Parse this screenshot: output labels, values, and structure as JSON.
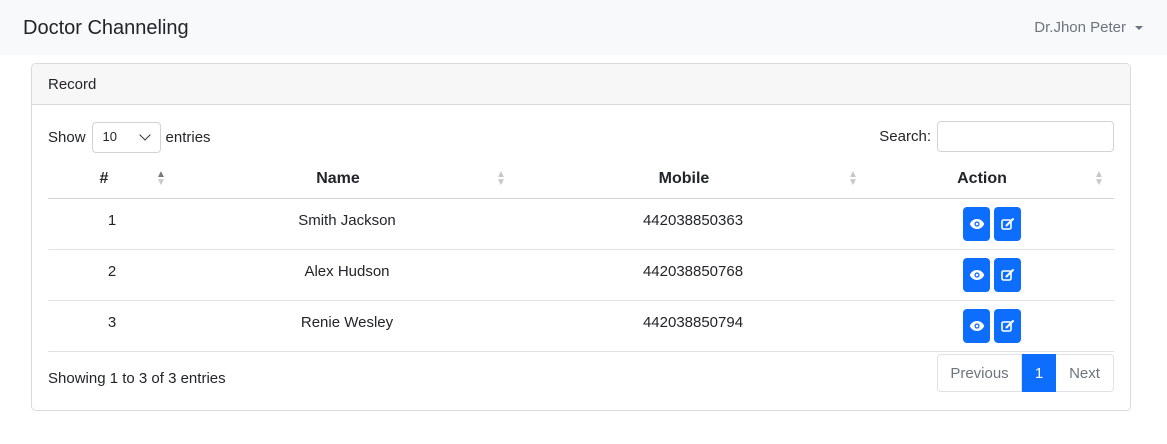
{
  "navbar": {
    "brand": "Doctor Channeling",
    "user": "Dr.Jhon Peter"
  },
  "card": {
    "title": "Record"
  },
  "controls": {
    "show_label": "Show",
    "page_length": "10",
    "entries_label": "entries",
    "search_label": "Search:",
    "search_value": ""
  },
  "table": {
    "columns": [
      "#",
      "Name",
      "Mobile",
      "Action"
    ],
    "rows": [
      {
        "num": "1",
        "name": "Smith Jackson",
        "mobile": "442038850363"
      },
      {
        "num": "2",
        "name": "Alex Hudson",
        "mobile": "442038850768"
      },
      {
        "num": "3",
        "name": "Renie Wesley",
        "mobile": "442038850794"
      }
    ],
    "sorted_column": "#",
    "sort_direction": "ascending"
  },
  "footer": {
    "info": "Showing 1 to 3 of 3 entries",
    "prev_label": "Previous",
    "current_page": "1",
    "next_label": "Next"
  },
  "icons": {
    "view": "eye-icon",
    "edit": "edit-icon",
    "sort": "sort-icon",
    "caret": "caret-down-icon"
  },
  "colors": {
    "primary": "#0d6efd",
    "navbar_bg": "#f8f9fa",
    "header_bg": "#f7f7f7"
  }
}
